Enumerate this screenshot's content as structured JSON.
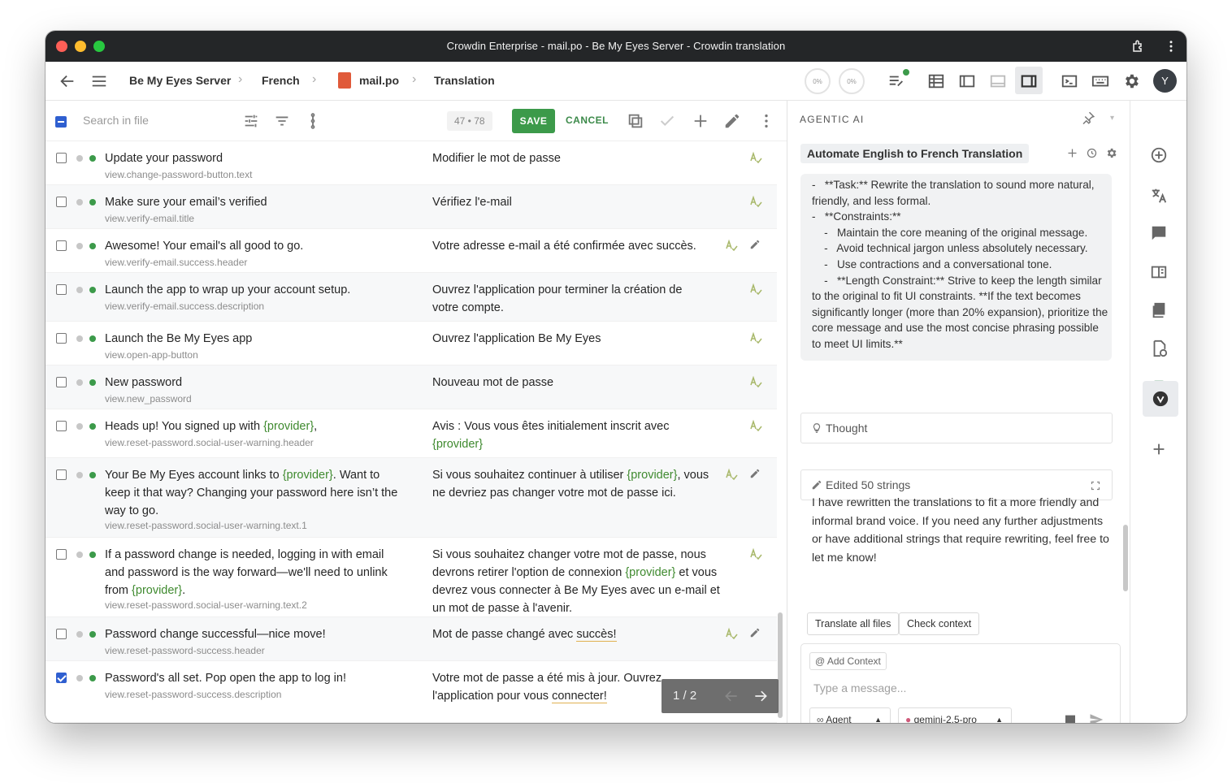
{
  "window": {
    "title": "Crowdin Enterprise - mail.po - Be My Eyes Server - Crowdin translation"
  },
  "breadcrumb": [
    {
      "label": "Be My Eyes Server"
    },
    {
      "label": "French"
    },
    {
      "label": "mail.po"
    },
    {
      "label": "Translation"
    }
  ],
  "progress": {
    "translated": "0%",
    "approved": "0%"
  },
  "user": {
    "initial": "Y"
  },
  "toolbar": {
    "search_placeholder": "Search in file",
    "counter_current": "47",
    "counter_total": "78",
    "counter_text": "47 • 78",
    "save_label": "SAVE",
    "cancel_label": "CANCEL"
  },
  "rows": [
    {
      "source": "Update your password",
      "key": "view.change-password-button.text",
      "target": "Modifier le mot de passe",
      "checked": false
    },
    {
      "source": "Make sure your email’s verified",
      "key": "view.verify-email.title",
      "target": "Vérifiez l'e-mail",
      "checked": false
    },
    {
      "source": "Awesome! Your email's all good to go.",
      "key": "view.verify-email.success.header",
      "target": "Votre adresse e-mail a été confirmée avec succès.",
      "checked": false
    },
    {
      "source": "Launch the app to wrap up your account setup.",
      "key": "view.verify-email.success.description",
      "target": "Ouvrez l'application pour terminer la création de votre compte.",
      "checked": false
    },
    {
      "source": "Launch the Be My Eyes app",
      "key": "view.open-app-button",
      "target": "Ouvrez l'application Be My Eyes",
      "checked": false
    },
    {
      "source": "New password",
      "key": "view.new_password",
      "target": "Nouveau mot de passe",
      "checked": false
    },
    {
      "source_pre": "Heads up! You signed up with ",
      "source_ph": "{provider}",
      "source_post": ",",
      "key": "view.reset-password.social-user-warning.header",
      "target_pre": "Avis : Vous vous êtes initialement inscrit avec ",
      "target_ph": "{provider}",
      "target_post": "",
      "checked": false
    },
    {
      "source_pre": "Your Be My Eyes account links to ",
      "source_ph": "{provider}",
      "source_post": ". Want to keep it that way? Changing your password here isn’t the way to go.",
      "key": "view.reset-password.social-user-warning.text.1",
      "target_pre": "Si vous souhaitez continuer à utiliser ",
      "target_ph": "{provider}",
      "target_post": ", vous ne devriez pas changer votre mot de passe ici.",
      "checked": false
    },
    {
      "source_pre": "If a password change is needed, logging in with email and password is the way forward—we'll need to unlink from ",
      "source_ph": "{provider}",
      "source_post": ".",
      "key": "view.reset-password.social-user-warning.text.2",
      "target_pre": "Si vous souhaitez changer votre mot de passe, nous devrons retirer l'option de connexion ",
      "target_ph": "{provider}",
      "target_post": " et vous devrez vous connecter à Be My Eyes avec un e-mail et un mot de passe à l'avenir.",
      "checked": false
    },
    {
      "source": "Password change successful—nice move!",
      "key": "view.reset-password-success.header",
      "target_pre": "Mot de passe changé avec ",
      "target_ul": "succès!",
      "checked": false
    },
    {
      "source": "Password's all set. Pop open the app to log in!",
      "key": "view.reset-password-success.description",
      "target_pre": "Votre mot de passe a été mis à jour. Ouvrez l'application pour vous ",
      "target_ul": "connecter!",
      "checked": true
    }
  ],
  "pager": {
    "text": "1 / 2"
  },
  "ai": {
    "header": "AGENTIC AI",
    "workflow_title": "Automate English to French Translation",
    "message": "-   **Task:** Rewrite the translation to sound more natural, friendly, and less formal.\n-   **Constraints:**\n    -   Maintain the core meaning of the original message.\n    -   Avoid technical jargon unless absolutely necessary.\n    -   Use contractions and a conversational tone.\n    -   **Length Constraint:** Strive to keep the length similar to the original to fit UI constraints. **If the text becomes significantly longer (more than 20% expansion), prioritize the core message and use the most concise phrasing possible to meet UI limits.**",
    "thought_label": "Thought",
    "edited_label": "Edited 50 strings",
    "reply": "I have rewritten the translations to fit a more friendly and informal brand voice. If you need any further adjustments or have additional strings that require rewriting, feel free to let me know!",
    "actions": [
      "Translate all files",
      "Check context"
    ],
    "add_context": "@ Add Context",
    "input_placeholder": "Type a message...",
    "mode": "Agent",
    "model": "gemini-2.5-pro"
  },
  "colors": {
    "accent_green": "#3c9a4a",
    "titlebar": "#242628",
    "checkbox_blue": "#2f5fd0",
    "placeholder_green": "#3f8a2f"
  }
}
